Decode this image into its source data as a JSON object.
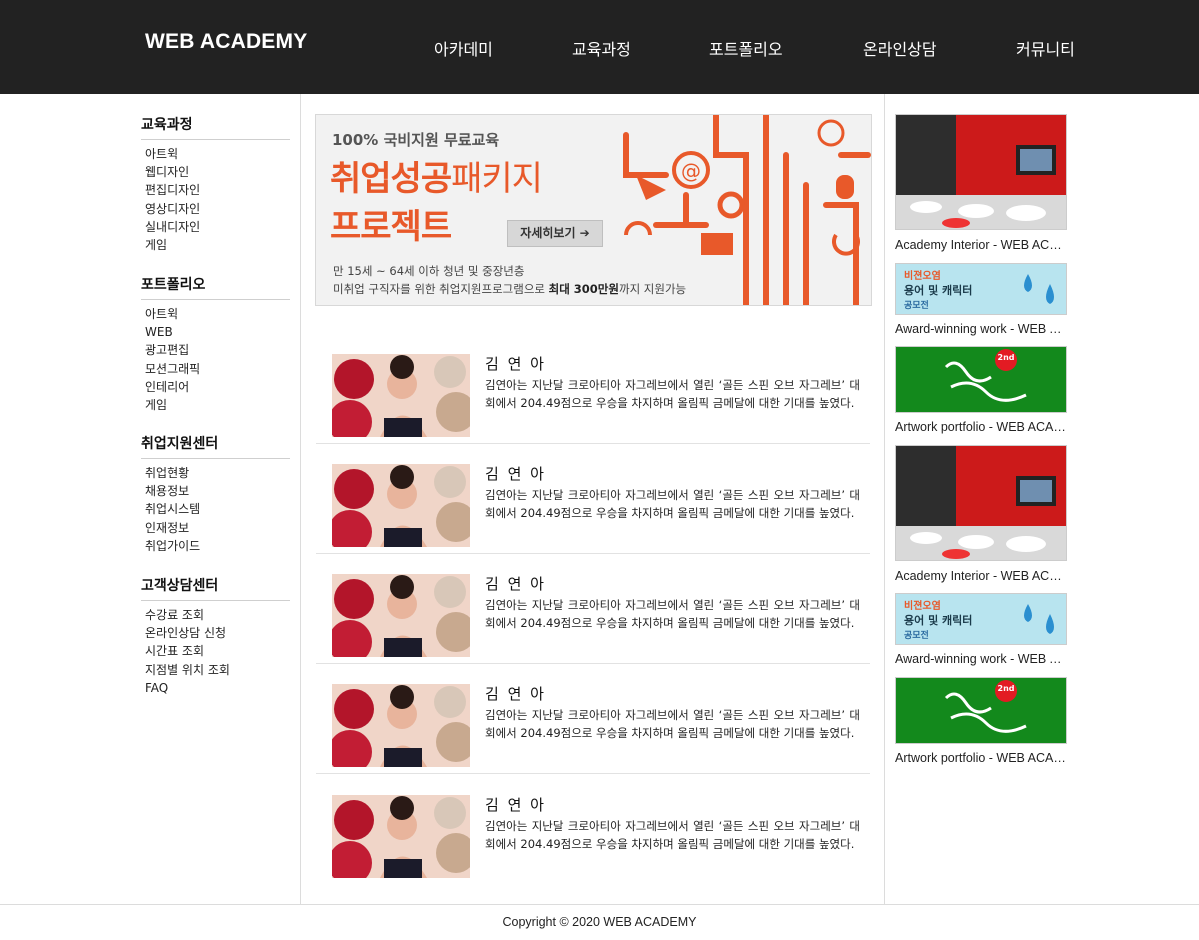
{
  "header": {
    "logo": "WEB ACADEMY",
    "nav": [
      "아카데미",
      "교육과정",
      "포트폴리오",
      "온라인상담",
      "커뮤니티"
    ]
  },
  "sidebar": {
    "groups": [
      {
        "title": "교육과정",
        "items": [
          "아트윅",
          "웹디자인",
          "편집디자인",
          "영상디자인",
          "실내디자인",
          "게임"
        ]
      },
      {
        "title": "포트폴리오",
        "items": [
          "아트윅",
          "WEB",
          "광고편집",
          "모션그래픽",
          "인테리어",
          "게임"
        ]
      },
      {
        "title": "취업지원센터",
        "items": [
          "취업현황",
          "채용정보",
          "취업시스템",
          "인재정보",
          "취업가이드"
        ]
      },
      {
        "title": "고객상담센터",
        "items": [
          "수강료 조회",
          "온라인상담 신청",
          "시간표 조회",
          "지점별 위치 조회",
          "FAQ"
        ]
      }
    ]
  },
  "banner": {
    "top": "100% 국비지원 무료교육",
    "headline_1a": "취업성공",
    "headline_1b": "패키지",
    "headline_2": "프로젝트",
    "button": "자세히보기 ➔",
    "sub_1": "만 15세 ~ 64세 이하 청년 및 중장년층",
    "sub_2a": "미취업 구직자를 위한 취업지원프로그램으로 ",
    "sub_2b": "최대 300만원",
    "sub_2c": "까지 지원가능",
    "accent": "#e8592a"
  },
  "news": [
    {
      "title": "김 연 아",
      "desc": "김연아는 지난달 크로아티아 자그레브에서 열린 ‘골든 스핀 오브 자그레브’ 대회에서 204.49점으로 우승을 차지하며 올림픽 금메달에 대한 기대를 높였다."
    },
    {
      "title": "김 연 아",
      "desc": "김연아는 지난달 크로아티아 자그레브에서 열린 ‘골든 스핀 오브 자그레브’ 대회에서 204.49점으로 우승을 차지하며 올림픽 금메달에 대한 기대를 높였다."
    },
    {
      "title": "김 연 아",
      "desc": "김연아는 지난달 크로아티아 자그레브에서 열린 ‘골든 스핀 오브 자그레브’ 대회에서 204.49점으로 우승을 차지하며 올림픽 금메달에 대한 기대를 높였다."
    },
    {
      "title": "김 연 아",
      "desc": "김연아는 지난달 크로아티아 자그레브에서 열린 ‘골든 스핀 오브 자그레브’ 대회에서 204.49점으로 우승을 차지하며 올림픽 금메달에 대한 기대를 높였다."
    },
    {
      "title": "김 연 아",
      "desc": "김연아는 지난달 크로아티아 자그레브에서 열린 ‘골든 스핀 오브 자그레브’ 대회에서 204.49점으로 우승을 차지하며 올림픽 금메달에 대한 기대를 높였다."
    }
  ],
  "right_column": [
    {
      "caption": "Academy Interior - WEB ACADEMY",
      "kind": "interior"
    },
    {
      "caption": "Award-winning work - WEB ACADEMY",
      "kind": "award",
      "art_line1": "비젼오염",
      "art_line2": "용어 및 캐릭터",
      "art_line3": "공모전"
    },
    {
      "caption": "Artwork portfolio - WEB ACADEMY",
      "kind": "artwork",
      "badge": "2nd"
    },
    {
      "caption": "Academy Interior - WEB ACADEMY",
      "kind": "interior"
    },
    {
      "caption": "Award-winning work - WEB ACADEMY",
      "kind": "award",
      "art_line1": "비젼오염",
      "art_line2": "용어 및 캐릭터",
      "art_line3": "공모전"
    },
    {
      "caption": "Artwork portfolio - WEB ACADEMY",
      "kind": "artwork",
      "badge": "2nd"
    }
  ],
  "footer": {
    "copyright": "Copyright © 2020 WEB ACADEMY"
  }
}
